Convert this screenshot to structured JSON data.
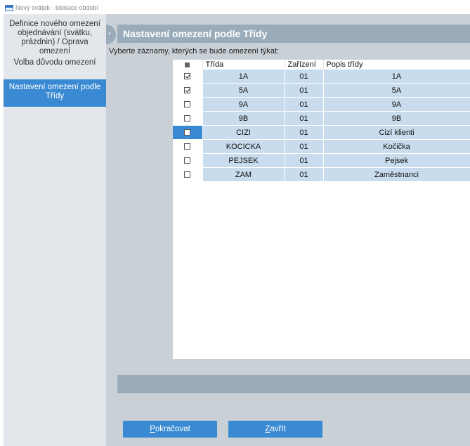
{
  "window": {
    "title": "Nový svátek - blokace období"
  },
  "sidebar": {
    "items": [
      {
        "label": "Definice nového omezení objednávání (svátku, prázdnin) / Oprava omezení",
        "active": false
      },
      {
        "label": "Volba důvodu omezení",
        "active": false
      },
      {
        "label": "Nastavení omezení podle Třídy",
        "active": true
      }
    ]
  },
  "header": {
    "title": "Nastavení omezení podle Třídy",
    "collapse_icon": "chevron-left-icon"
  },
  "prompt": "Vyberte záznamy, kterých se bude omezení týkat:",
  "table": {
    "columns": [
      "Třída",
      "Zařízení",
      "Popis třídy"
    ],
    "rows": [
      {
        "checked": true,
        "trida": "1A",
        "zarizeni": "01",
        "popis": "1A"
      },
      {
        "checked": true,
        "trida": "5A",
        "zarizeni": "01",
        "popis": "5A"
      },
      {
        "checked": false,
        "trida": "9A",
        "zarizeni": "01",
        "popis": "9A"
      },
      {
        "checked": false,
        "trida": "9B",
        "zarizeni": "01",
        "popis": "9B"
      },
      {
        "checked": false,
        "trida": "CIZI",
        "zarizeni": "01",
        "popis": "Cizí klienti",
        "selected": true
      },
      {
        "checked": false,
        "trida": "KOCICKA",
        "zarizeni": "01",
        "popis": "Kočička"
      },
      {
        "checked": false,
        "trida": "PEJSEK",
        "zarizeni": "01",
        "popis": "Pejsek"
      },
      {
        "checked": false,
        "trida": "ZAM",
        "zarizeni": "01",
        "popis": "Zaměstnanci"
      }
    ]
  },
  "buttons": {
    "continue": {
      "mnemonic": "P",
      "rest": "okračovat"
    },
    "close": {
      "mnemonic": "Z",
      "rest": "avřít"
    }
  },
  "colors": {
    "accent": "#3a8ad3",
    "header": "#9aacba",
    "row": "#c8dcee",
    "panel": "#c9d1d7",
    "sidebar": "#e3e6ea"
  }
}
